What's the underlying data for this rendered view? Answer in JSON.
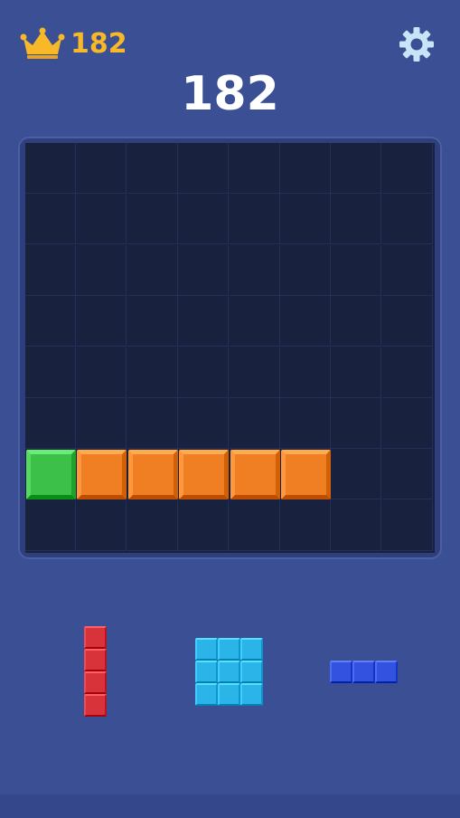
{
  "header": {
    "best_score": "182",
    "crown_icon": "crown-icon",
    "settings_icon": "gear-icon"
  },
  "score": "182",
  "board": {
    "rows": 8,
    "cols": 8,
    "filled": [
      {
        "row": 6,
        "col": 0,
        "color": "green"
      },
      {
        "row": 6,
        "col": 1,
        "color": "orange"
      },
      {
        "row": 6,
        "col": 2,
        "color": "orange"
      },
      {
        "row": 6,
        "col": 3,
        "color": "orange"
      },
      {
        "row": 6,
        "col": 4,
        "color": "orange"
      },
      {
        "row": 6,
        "col": 5,
        "color": "orange"
      }
    ]
  },
  "pieces": [
    {
      "name": "red-vertical-4",
      "color": "red",
      "cells": [
        [
          0,
          0
        ],
        [
          1,
          0
        ],
        [
          2,
          0
        ],
        [
          3,
          0
        ]
      ]
    },
    {
      "name": "cyan-square-3x3",
      "color": "cyan",
      "cells": [
        [
          0,
          0
        ],
        [
          0,
          1
        ],
        [
          0,
          2
        ],
        [
          1,
          0
        ],
        [
          1,
          1
        ],
        [
          1,
          2
        ],
        [
          2,
          0
        ],
        [
          2,
          1
        ],
        [
          2,
          2
        ]
      ]
    },
    {
      "name": "blue-horizontal-3",
      "color": "blue",
      "cells": [
        [
          0,
          0
        ],
        [
          0,
          1
        ],
        [
          0,
          2
        ]
      ]
    }
  ],
  "colors": {
    "green": "#3cc04a",
    "orange": "#f07f24",
    "red": "#d8323a",
    "cyan": "#2ab4e8",
    "blue": "#3352e0",
    "accent_gold": "#f7b928",
    "background": "#3a4f94",
    "board": "#18223f"
  }
}
